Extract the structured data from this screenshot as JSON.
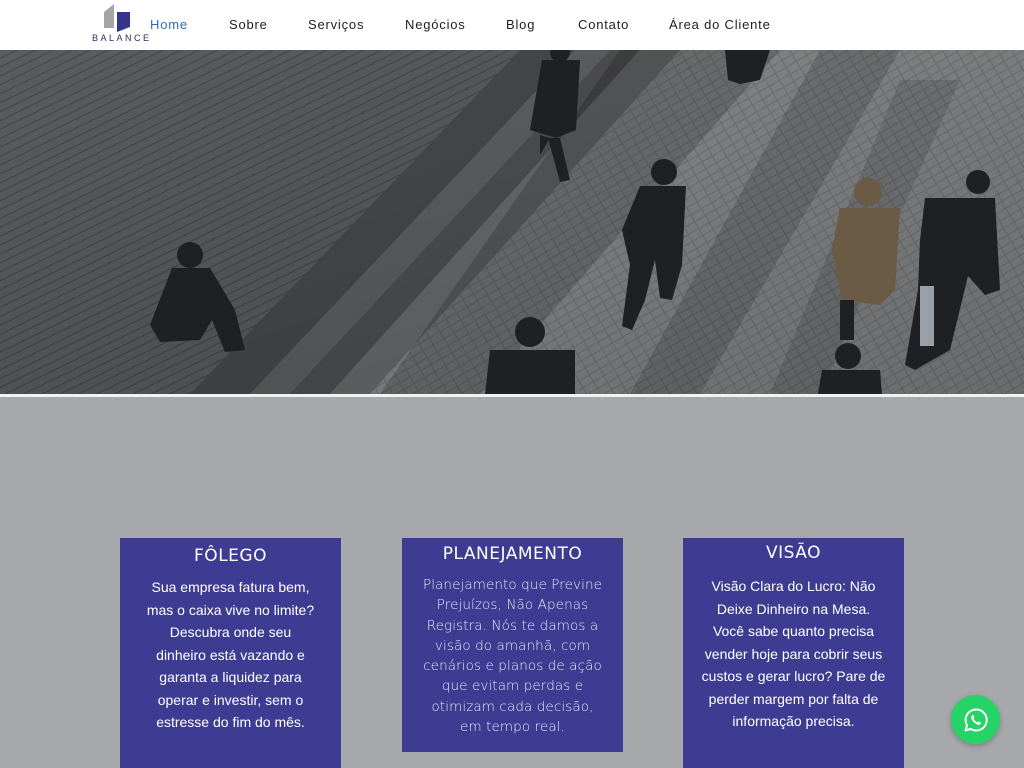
{
  "brand": {
    "name": "BALANCE",
    "logo_colors": [
      "#a3a5a8",
      "#33348a"
    ]
  },
  "nav": {
    "items": [
      {
        "label": "Home",
        "active": true
      },
      {
        "label": "Sobre",
        "active": false
      },
      {
        "label": "Serviços",
        "active": false
      },
      {
        "label": "Negócios",
        "active": false
      },
      {
        "label": "Blog",
        "active": false
      },
      {
        "label": "Contato",
        "active": false
      },
      {
        "label": "Área do Cliente",
        "active": false
      }
    ]
  },
  "hero": {
    "image": "people-walking-on-plaza-photo"
  },
  "cards": [
    {
      "title": "FÔLEGO",
      "body": "Sua empresa fatura bem, mas o caixa vive no limite? Descubra onde seu dinheiro está vazando e garanta a liquidez para operar e investir, sem o estresse do fim do mês."
    },
    {
      "title": "PLANEJAMENTO",
      "body": "Planejamento que Previne Prejuízos, Não Apenas Registra. Nós te damos a visão do amanhã, com cenários e planos de ação que evitam perdas e otimizam cada decisão, em tempo real."
    },
    {
      "title": "VISÃO",
      "body": "Visão Clara do Lucro: Não Deixe Dinheiro na Mesa. Você sabe quanto precisa vender hoje para cobrir seus custos e gerar lucro? Pare de perder margem por falta de informação precisa."
    }
  ],
  "colors": {
    "card_bg": "#3e3c92",
    "page_bg": "#a6a8ab",
    "nav_active": "#2f6fb6",
    "whatsapp": "#25d366"
  },
  "fab": {
    "icon": "whatsapp-icon"
  }
}
